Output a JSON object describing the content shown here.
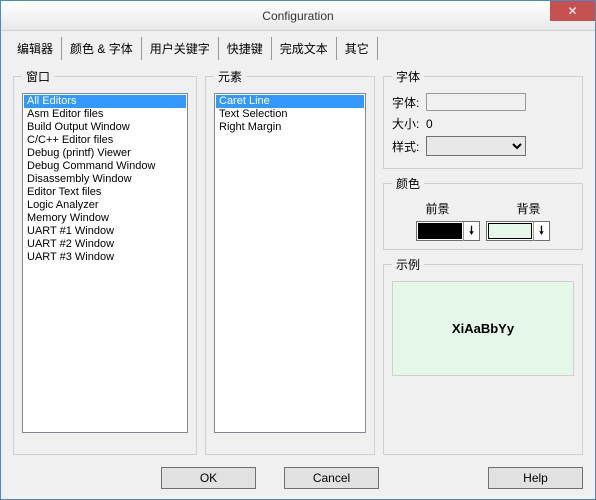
{
  "window": {
    "title": "Configuration"
  },
  "tabs": [
    {
      "label": "编辑器"
    },
    {
      "label": "颜色 & 字体"
    },
    {
      "label": "用户关键字"
    },
    {
      "label": "快捷键"
    },
    {
      "label": "完成文本"
    },
    {
      "label": "其它"
    }
  ],
  "active_tab": 1,
  "groups": {
    "windows_legend": "窗口",
    "elements_legend": "元素",
    "font_legend": "字体",
    "color_legend": "颜色",
    "sample_legend": "示例"
  },
  "windows_list": [
    "All Editors",
    "Asm Editor files",
    "Build Output Window",
    "C/C++ Editor files",
    "Debug (printf) Viewer",
    "Debug Command Window",
    "Disassembly Window",
    "Editor Text files",
    "Logic Analyzer",
    "Memory Window",
    "UART #1 Window",
    "UART #2 Window",
    "UART #3 Window"
  ],
  "windows_selected": 0,
  "elements_list": [
    "Caret Line",
    "Text Selection",
    "Right Margin"
  ],
  "elements_selected": 0,
  "font": {
    "family_label": "字体:",
    "family_value": "",
    "size_label": "大小:",
    "size_value": "0",
    "style_label": "样式:",
    "style_value": ""
  },
  "colors": {
    "fg_label": "前景",
    "bg_label": "背景",
    "fg_value": "#000000",
    "bg_value": "#e4f7e8"
  },
  "sample_text": "XiAaBbYy",
  "buttons": {
    "ok": "OK",
    "cancel": "Cancel",
    "help": "Help"
  }
}
